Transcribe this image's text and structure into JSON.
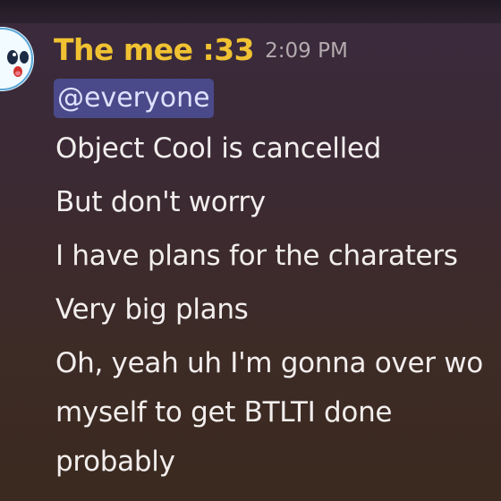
{
  "message": {
    "author": "The mee :33",
    "timestamp": "2:09 PM",
    "mention": "@everyone",
    "lines": [
      "Object Cool is cancelled",
      "But don't worry",
      "I have plans for the charaters",
      "Very big plans",
      "Oh, yeah uh I'm gonna over wo",
      "myself to get BTLTI done",
      "probably"
    ]
  },
  "colors": {
    "author": "#f0c232",
    "mention_bg": "#4a4a8a",
    "text": "#f2eeed",
    "timestamp": "#b3abae"
  },
  "icons": {
    "avatar": "ghost-face-avatar"
  }
}
